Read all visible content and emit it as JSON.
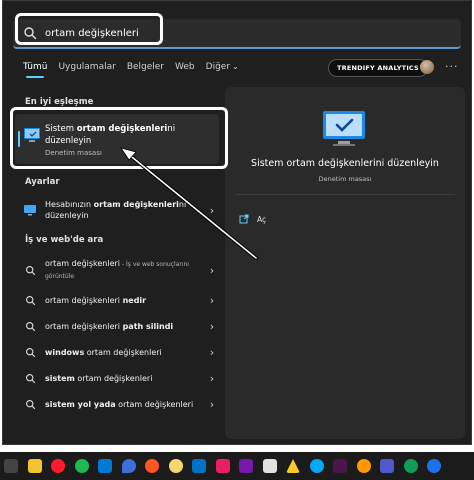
{
  "search": {
    "query": "ortam değişkenleri"
  },
  "tabs": [
    {
      "label": "Tümü"
    },
    {
      "label": "Uygulamalar"
    },
    {
      "label": "Belgeler"
    },
    {
      "label": "Web"
    },
    {
      "label": "Diğer"
    }
  ],
  "header": {
    "brand": "TRENDIFY ANALYTICS"
  },
  "best_match": {
    "heading": "En iyi eşleşme",
    "title_pre": "Sistem ",
    "title_bold": "ortam değişkenleri",
    "title_post": "ni düzenleyin",
    "subtitle": "Denetim masası"
  },
  "settings": {
    "heading": "Ayarlar",
    "item_pre": "Hesabınızın ",
    "item_bold": "ortam değişkenleri",
    "item_post": "ni düzenleyin"
  },
  "web": {
    "heading": "İş ve web'de ara",
    "items": [
      {
        "pre": "",
        "bold": "",
        "text": "ortam değişkenleri",
        "small": " - İş ve web sonuçlarını görüntüle"
      },
      {
        "pre": "ortam değişkenleri ",
        "bold": "nedir",
        "text": "",
        "small": ""
      },
      {
        "pre": "ortam değişkenleri ",
        "bold": "path silindi",
        "text": "",
        "small": ""
      },
      {
        "pre": "",
        "bold": "windows",
        "text": " ortam değişkenleri",
        "small": ""
      },
      {
        "pre": "",
        "bold": "sistem",
        "text": " ortam değişkenleri",
        "small": ""
      },
      {
        "pre": "",
        "bold": "sistem yol yada",
        "text": " ortam değişkenleri",
        "small": ""
      }
    ]
  },
  "preview": {
    "title": "Sistem ortam değişkenlerini düzenleyin",
    "subtitle": "Denetim masası",
    "open_label": "Aç"
  },
  "colors": {
    "accent": "#60cdff",
    "background": "#1f1f1f",
    "panel": "#2a2a2a"
  }
}
